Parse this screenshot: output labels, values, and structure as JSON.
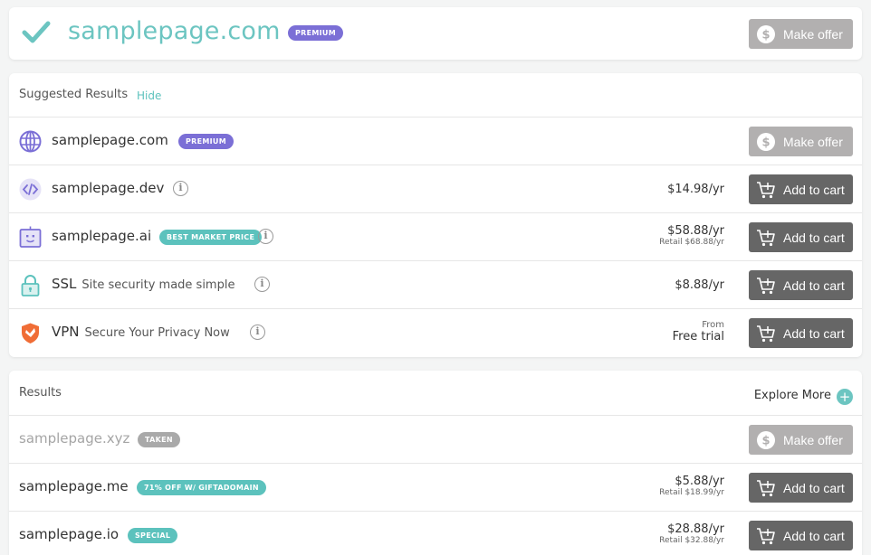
{
  "hero": {
    "domain": "samplepage.com",
    "badge": "PREMIUM",
    "button_label": "Make offer"
  },
  "suggested": {
    "title": "Suggested Results",
    "hide_label": "Hide",
    "rows": [
      {
        "icon": "globe-icon",
        "name": "samplepage.com",
        "badge": "PREMIUM",
        "button": "Make offer"
      },
      {
        "icon": "code-icon",
        "name": "samplepage.dev",
        "price": "$14.98/yr",
        "button": "Add to cart"
      },
      {
        "icon": "robot-icon",
        "name": "samplepage.ai",
        "badge": "BEST MARKET PRICE",
        "price": "$58.88/yr",
        "retail": "Retail $68.88/yr",
        "button": "Add to cart"
      },
      {
        "icon": "lock-icon",
        "name": "SSL",
        "desc": "Site security made simple",
        "price": "$8.88/yr",
        "button": "Add to cart"
      },
      {
        "icon": "vpn-shield-icon",
        "name": "VPN",
        "desc": "Secure Your Privacy Now",
        "from": "From",
        "price": "Free trial",
        "button": "Add to cart"
      }
    ]
  },
  "results": {
    "title": "Results",
    "explore_label": "Explore More",
    "rows": [
      {
        "name": "samplepage.xyz",
        "badge": "TAKEN",
        "button": "Make offer"
      },
      {
        "name": "samplepage.me",
        "badge": "71% OFF W/ GIFTADOMAIN",
        "price": "$5.88/yr",
        "retail": "Retail $18.99/yr",
        "button": "Add to cart"
      },
      {
        "name": "samplepage.io",
        "badge": "SPECIAL",
        "price": "$28.88/yr",
        "retail": "Retail $32.88/yr",
        "button": "Add to cart"
      }
    ]
  },
  "colors": {
    "teal": "#6cc5c1",
    "premium": "#7b6fd6",
    "button_dark": "#666666",
    "button_gray": "#b2b0b0"
  }
}
